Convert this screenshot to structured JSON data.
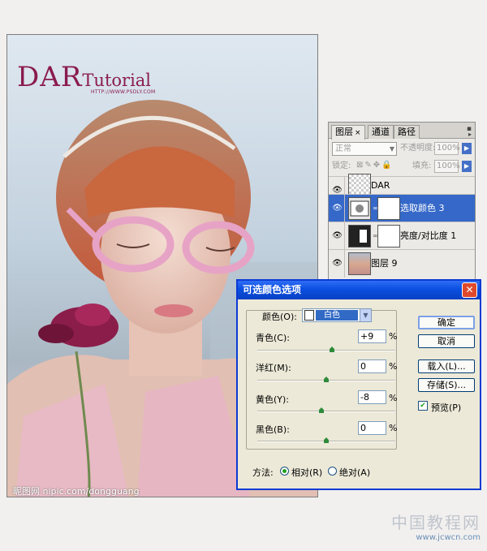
{
  "photo": {
    "brand_big": "DAR",
    "brand_small": "Tutorial",
    "brand_url": "HTTP://WWW.PSDLY.COM",
    "credit": "昵图网 nipic.com/dongguang"
  },
  "layers_panel": {
    "tabs": [
      {
        "label": "图层",
        "close": "×"
      },
      {
        "label": "通道"
      },
      {
        "label": "路径"
      }
    ],
    "blend_mode": "正常",
    "opacity_label": "不透明度:",
    "opacity_value": "100%",
    "lock_label": "锁定:",
    "fill_label": "填充:",
    "fill_value": "100%",
    "layers": [
      {
        "name": "DAR",
        "visible": true
      },
      {
        "name": "选取颜色 3",
        "visible": true,
        "selected": true
      },
      {
        "name": "亮度/对比度 1",
        "visible": true
      },
      {
        "name": "图层 9",
        "visible": true
      }
    ]
  },
  "dialog": {
    "title": "可选颜色选项",
    "close": "✕",
    "color_label": "颜色(O):",
    "color_value": "白色",
    "sliders": [
      {
        "label": "青色(C):",
        "value": "+9",
        "unit": "%",
        "position": 0.545
      },
      {
        "label": "洋红(M):",
        "value": "0",
        "unit": "%",
        "position": 0.5
      },
      {
        "label": "黄色(Y):",
        "value": "-8",
        "unit": "%",
        "position": 0.46
      },
      {
        "label": "黑色(B):",
        "value": "0",
        "unit": "%",
        "position": 0.5
      }
    ],
    "buttons": {
      "ok": "确定",
      "cancel": "取消",
      "load": "载入(L)...",
      "save": "存储(S)..."
    },
    "preview_label": "预览(P)",
    "preview_checked": true,
    "method_label": "方法:",
    "method_relative": "相对(R)",
    "method_absolute": "绝对(A)",
    "method_selected": "relative"
  },
  "watermark": {
    "title": "中国教程网",
    "url": "www.jcwcn.com"
  },
  "colors": {
    "brand": "#8a1b4f",
    "selection": "#3568c8",
    "dialog_title": "#0a4fe0",
    "slider_knob": "#2e8b3a"
  }
}
